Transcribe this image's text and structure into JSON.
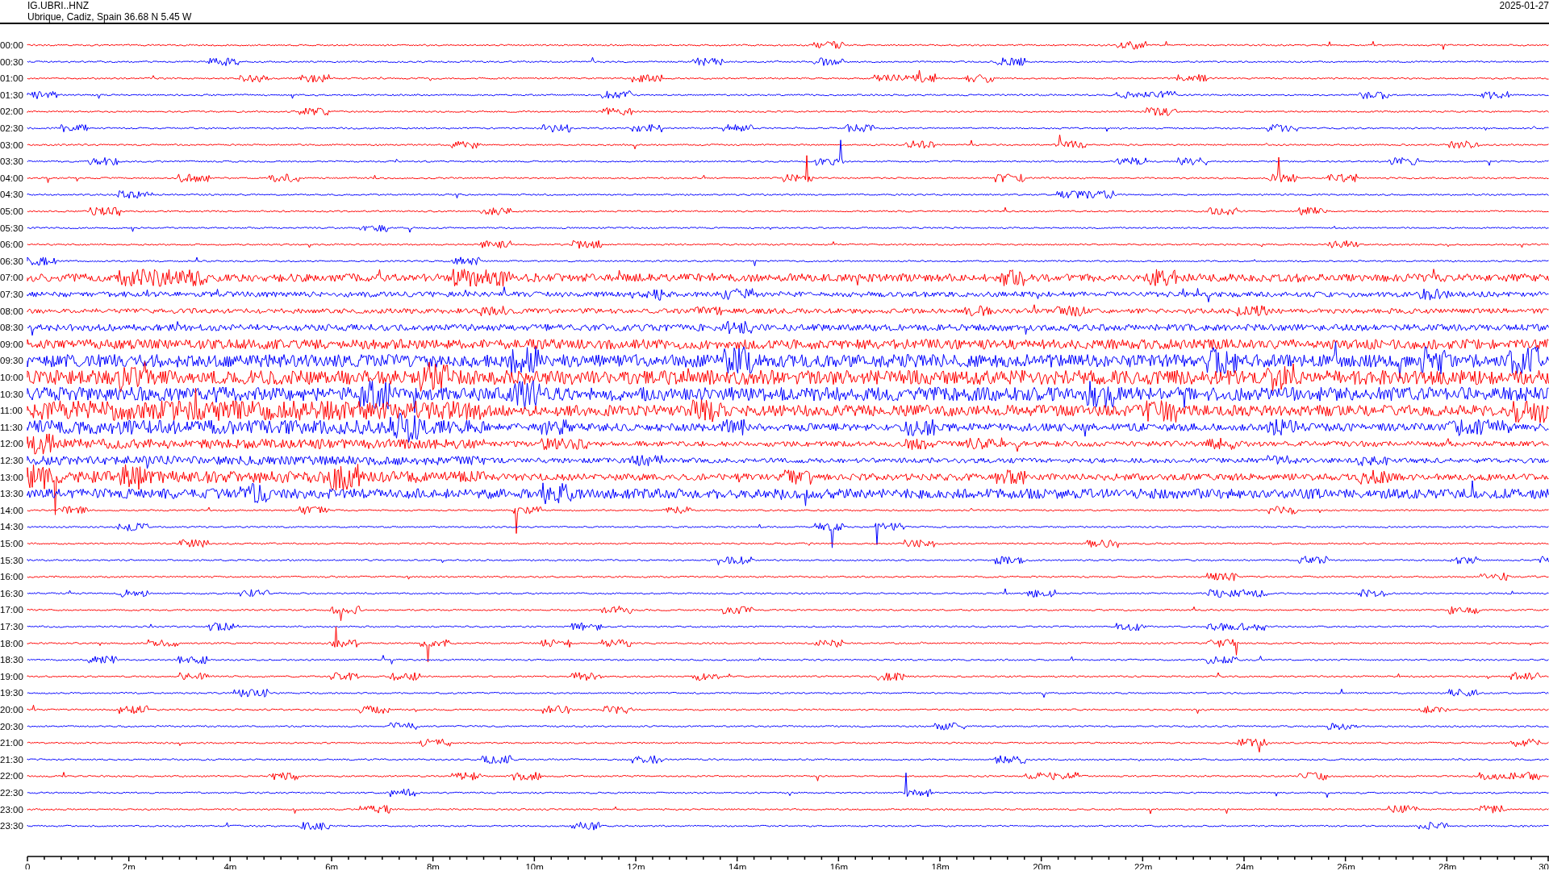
{
  "header": {
    "station": "IG.UBRI..HNZ",
    "location": "Ubrique, Cadiz, Spain  36.68 N 5.45 W",
    "date": "2025-01-27"
  },
  "rows": [
    {
      "label": "00:00",
      "color": "#ff0000"
    },
    {
      "label": "00:30",
      "color": "#0000ff"
    },
    {
      "label": "01:00",
      "color": "#ff0000"
    },
    {
      "label": "01:30",
      "color": "#0000ff"
    },
    {
      "label": "02:00",
      "color": "#ff0000"
    },
    {
      "label": "02:30",
      "color": "#0000ff"
    },
    {
      "label": "03:00",
      "color": "#ff0000"
    },
    {
      "label": "03:30",
      "color": "#0000ff"
    },
    {
      "label": "04:00",
      "color": "#ff0000"
    },
    {
      "label": "04:30",
      "color": "#0000ff"
    },
    {
      "label": "05:00",
      "color": "#ff0000"
    },
    {
      "label": "05:30",
      "color": "#0000ff"
    },
    {
      "label": "06:00",
      "color": "#ff0000"
    },
    {
      "label": "06:30",
      "color": "#0000ff"
    },
    {
      "label": "07:00",
      "color": "#ff0000"
    },
    {
      "label": "07:30",
      "color": "#0000ff"
    },
    {
      "label": "08:00",
      "color": "#ff0000"
    },
    {
      "label": "08:30",
      "color": "#0000ff"
    },
    {
      "label": "09:00",
      "color": "#ff0000"
    },
    {
      "label": "09:30",
      "color": "#0000ff"
    },
    {
      "label": "10:00",
      "color": "#ff0000"
    },
    {
      "label": "10:30",
      "color": "#0000ff"
    },
    {
      "label": "11:00",
      "color": "#ff0000"
    },
    {
      "label": "11:30",
      "color": "#0000ff"
    },
    {
      "label": "12:00",
      "color": "#ff0000"
    },
    {
      "label": "12:30",
      "color": "#0000ff"
    },
    {
      "label": "13:00",
      "color": "#ff0000"
    },
    {
      "label": "13:30",
      "color": "#0000ff"
    },
    {
      "label": "14:00",
      "color": "#ff0000"
    },
    {
      "label": "14:30",
      "color": "#0000ff"
    },
    {
      "label": "15:00",
      "color": "#ff0000"
    },
    {
      "label": "15:30",
      "color": "#0000ff"
    },
    {
      "label": "16:00",
      "color": "#ff0000"
    },
    {
      "label": "16:30",
      "color": "#0000ff"
    },
    {
      "label": "17:00",
      "color": "#ff0000"
    },
    {
      "label": "17:30",
      "color": "#0000ff"
    },
    {
      "label": "18:00",
      "color": "#ff0000"
    },
    {
      "label": "18:30",
      "color": "#0000ff"
    },
    {
      "label": "19:00",
      "color": "#ff0000"
    },
    {
      "label": "19:30",
      "color": "#0000ff"
    },
    {
      "label": "20:00",
      "color": "#ff0000"
    },
    {
      "label": "20:30",
      "color": "#0000ff"
    },
    {
      "label": "21:00",
      "color": "#ff0000"
    },
    {
      "label": "21:30",
      "color": "#0000ff"
    },
    {
      "label": "22:00",
      "color": "#ff0000"
    },
    {
      "label": "22:30",
      "color": "#0000ff"
    },
    {
      "label": "23:00",
      "color": "#ff0000"
    },
    {
      "label": "23:30",
      "color": "#0000ff"
    }
  ],
  "x_axis": {
    "ticks": [
      "0",
      "2m",
      "4m",
      "6m",
      "8m",
      "10m",
      "12m",
      "14m",
      "16m",
      "18m",
      "20m",
      "22m",
      "24m",
      "26m",
      "28m",
      "30"
    ]
  }
}
